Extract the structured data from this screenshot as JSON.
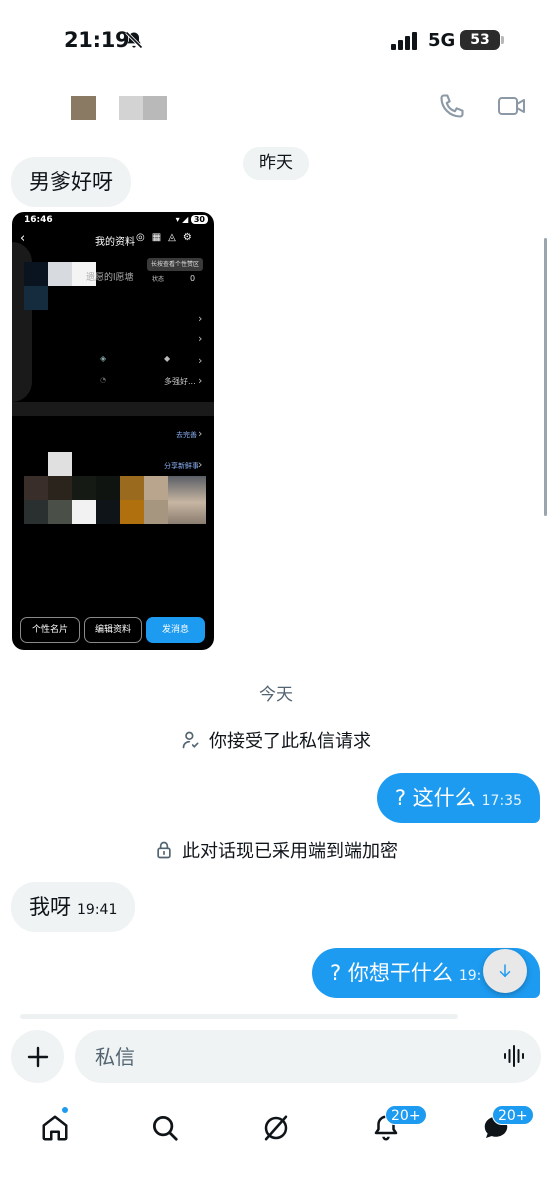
{
  "status_bar": {
    "time": "21:19",
    "network": "5G",
    "battery": "53",
    "icons": [
      "bell-slash-icon",
      "cellular-signal-icon"
    ]
  },
  "header": {
    "icons": [
      "phone-icon",
      "video-camera-icon"
    ]
  },
  "chat": {
    "day_yesterday": "昨天",
    "day_today": "今天",
    "msg_1": {
      "text": "男爹好呀"
    },
    "shared_image": {
      "status_time": "16:46",
      "status_battery": "30",
      "back": "‹",
      "title": "我的资料",
      "tooltip": "长按查看个性赞区",
      "status_tag": "状态",
      "like_count": "0",
      "blurred_text": "遗愿的l愿塘",
      "strong_text": "多强好...",
      "link_complete": "去完善",
      "link_share": "分享新鲜事",
      "btn_card": "个性名片",
      "btn_edit": "编辑资料",
      "btn_message": "发消息"
    },
    "system_accepted": "你接受了此私信请求",
    "msg_2": {
      "text": "? 这什么",
      "time": "17:35"
    },
    "system_encrypted": "此对话现已采用端到端加密",
    "msg_3": {
      "text": "我呀",
      "time": "19:41"
    },
    "msg_4": {
      "text": "? 你想干什么",
      "time": "19:"
    }
  },
  "composer": {
    "placeholder": "私信"
  },
  "bottom_nav": {
    "notifications_badge": "20+",
    "messages_badge": "20+"
  },
  "colors": {
    "accent": "#1d9bf0",
    "bubble_incoming": "#eff3f4",
    "muted_text": "#536471"
  }
}
